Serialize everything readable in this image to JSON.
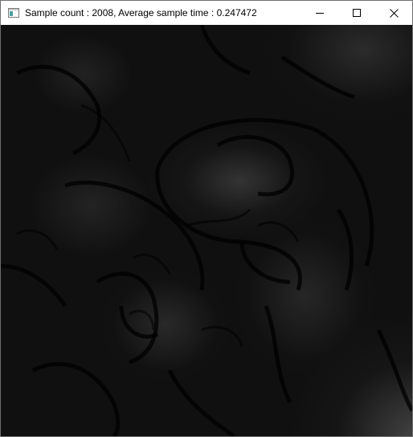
{
  "window": {
    "title": "Sample count : 2008, Average sample time : 0.247472",
    "app_icon": "window-app-icon",
    "controls": {
      "minimize_icon": "minimize-icon",
      "maximize_icon": "maximize-icon",
      "close_icon": "close-icon"
    }
  },
  "render": {
    "background_color": "#101010",
    "highlight_color": "#3a3a3a",
    "contour_color": "#000000"
  }
}
